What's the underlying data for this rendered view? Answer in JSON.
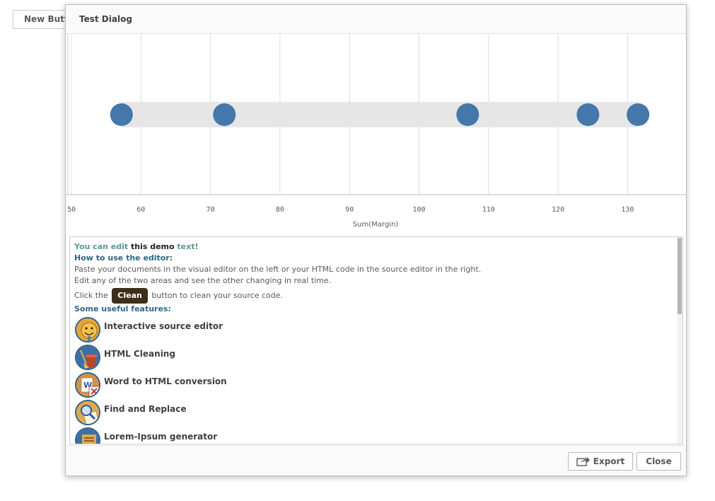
{
  "background_button": {
    "label": "New Button"
  },
  "dialog": {
    "title": "Test Dialog",
    "footer": {
      "export_label": "Export",
      "close_label": "Close"
    }
  },
  "chart_data": {
    "type": "scatter",
    "xlabel": "Sum(Margin)",
    "xticks": [
      50,
      60,
      70,
      80,
      90,
      100,
      110,
      120,
      130
    ],
    "xlim": [
      50,
      139
    ],
    "points": [
      57.2,
      72,
      107,
      124.3,
      131.5
    ],
    "point_color": "#4477aa",
    "band_color": "#e6e6e6",
    "grid": true
  },
  "editor": {
    "intro": {
      "part1": "You can edit ",
      "part2": "this demo",
      "part3": " text!"
    },
    "how_heading": "How to use the editor:",
    "line1": "Paste your documents in the visual editor on the left or your HTML code in the source editor in the right.",
    "line2": "Edit any of the two areas and see the other changing in real time.",
    "clean_before": "Click the ",
    "clean_label": "Clean",
    "clean_after": " button to clean your source code.",
    "features_heading": "Some useful features:",
    "features": [
      {
        "label": "Interactive source editor",
        "icon": "smiley-icon"
      },
      {
        "label": "HTML Cleaning",
        "icon": "broom-bucket-icon"
      },
      {
        "label": "Word to HTML conversion",
        "icon": "word-doc-icon"
      },
      {
        "label": "Find and Replace",
        "icon": "magnifier-icon"
      },
      {
        "label": "Lorem-Ipsum generator",
        "icon": "lorem-icon"
      }
    ]
  }
}
